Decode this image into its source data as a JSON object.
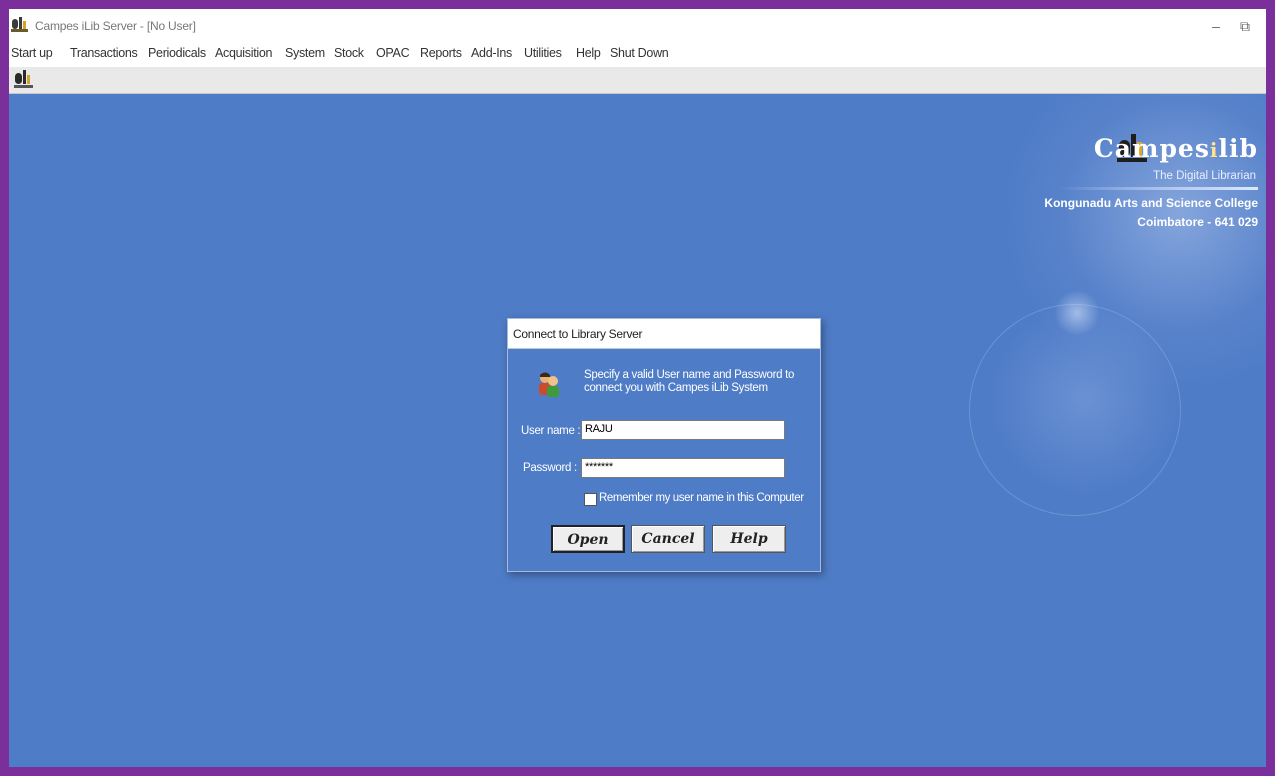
{
  "window": {
    "title": "Campes iLib Server - [No User]",
    "minimize_glyph": "–",
    "restore_glyph": "⧉"
  },
  "menu": [
    {
      "label": "Start up"
    },
    {
      "label": "Transactions"
    },
    {
      "label": "Periodicals"
    },
    {
      "label": "Acquisition"
    },
    {
      "label": "System"
    },
    {
      "label": "Stock"
    },
    {
      "label": "OPAC"
    },
    {
      "label": "Reports"
    },
    {
      "label": "Add-Ins"
    },
    {
      "label": "Utilities"
    },
    {
      "label": "Help"
    },
    {
      "label": "Shut Down"
    }
  ],
  "toolbar": {
    "icon": "dl-logo-icon"
  },
  "brand": {
    "name_part1": "Campes",
    "name_part2": "i",
    "name_part3": "lib",
    "tagline": "The Digital Librarian",
    "college": "Kongunadu Arts and Science College",
    "city": "Coimbatore - 641 029"
  },
  "dialog": {
    "title": "Connect to Library Server",
    "message": "Specify a valid User name and Password to connect you with Campes iLib System",
    "username_label": "User name :",
    "username_value": "RAJU",
    "password_label": "Password :",
    "password_value": "*******",
    "remember_label": "Remember my user name in this Computer",
    "remember_checked": false,
    "open_label": "Open",
    "cancel_label": "Cancel",
    "help_label": "Help"
  },
  "colors": {
    "frame": "#7a2f9a",
    "desktop": "#4f7cc7",
    "toolbar": "#e9e9e9"
  }
}
